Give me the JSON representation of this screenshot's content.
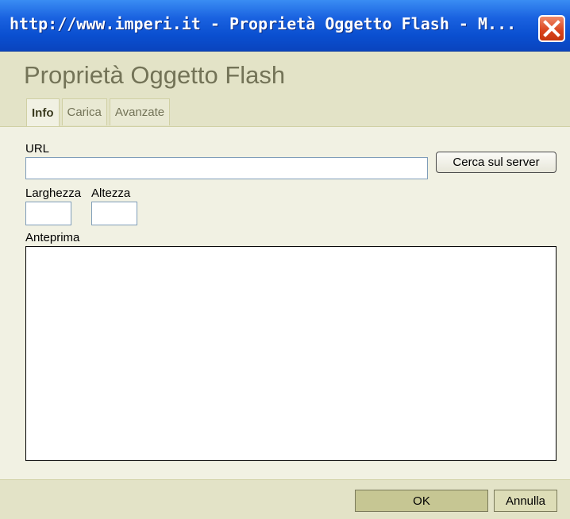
{
  "window": {
    "title": "http://www.imperi.it - Proprietà Oggetto Flash - M...",
    "close_icon": "close-x-icon"
  },
  "dialog": {
    "title": "Proprietà Oggetto Flash",
    "tabs": [
      {
        "label": "Info",
        "active": true
      },
      {
        "label": "Carica",
        "active": false
      },
      {
        "label": "Avanzate",
        "active": false
      }
    ]
  },
  "info_panel": {
    "url_label": "URL",
    "url_value": "",
    "browse_button": "Cerca sul server",
    "width_label": "Larghezza",
    "width_value": "",
    "height_label": "Altezza",
    "height_value": "",
    "preview_label": "Anteprima"
  },
  "footer": {
    "ok_label": "OK",
    "cancel_label": "Annulla"
  },
  "colors": {
    "titlebar": "#0a4fd0",
    "dialog_background": "#f1f1e3",
    "header_background": "#e3e3c7",
    "close_button": "#d9431c",
    "ok_button": "#c6c693"
  }
}
